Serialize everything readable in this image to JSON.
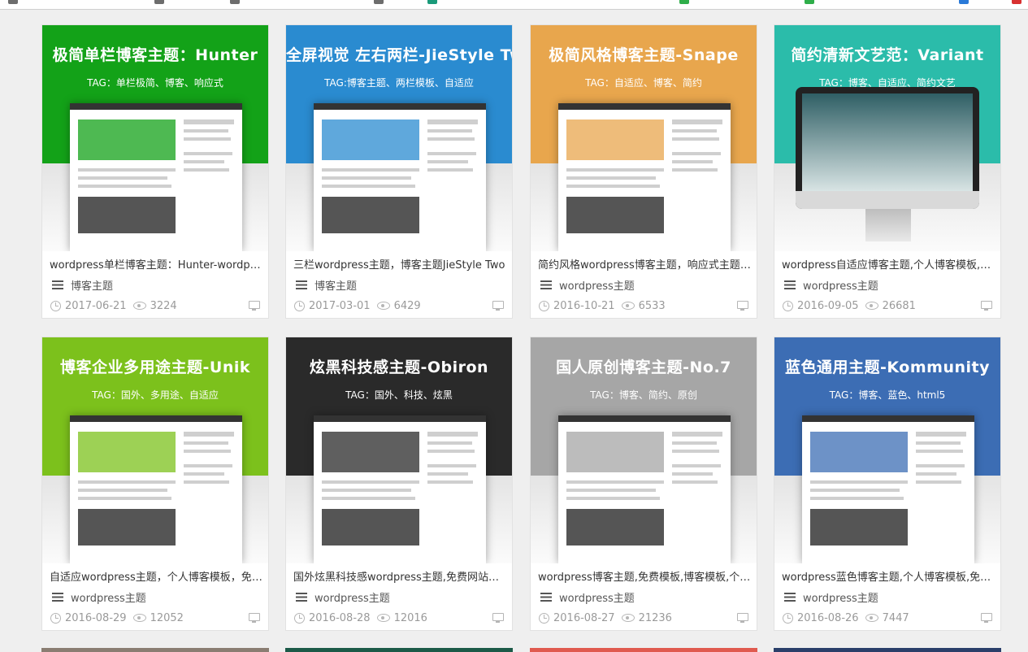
{
  "cards": [
    {
      "title": "极简单栏博客主题：Hunter",
      "tag": "TAG：单栏极简、博客、响应式",
      "bg": "#13a218",
      "desc": "wordpress单栏博客主题：Hunter-wordpress主题",
      "category": "博客主题",
      "date": "2017-06-21",
      "views": "3224",
      "style": "shot"
    },
    {
      "title": "全屏视觉 左右两栏-JieStyle Two",
      "tag": "TAG:博客主题、两栏模板、自适应",
      "bg": "#2a8bd0",
      "desc": "三栏wordpress主题，博客主题JieStyle Two",
      "category": "博客主题",
      "date": "2017-03-01",
      "views": "6429",
      "style": "shot"
    },
    {
      "title": "极简风格博客主题-Snape",
      "tag": "TAG：自适应、博客、简约",
      "bg": "#e8a64d",
      "desc": "简约风格wordpress博客主题，响应式主题-Snape",
      "category": "wordpress主题",
      "date": "2016-10-21",
      "views": "6533",
      "style": "shot"
    },
    {
      "title": "简约清新文艺范：Variant",
      "tag": "TAG：博客、自适应、简约文艺",
      "bg": "#2bbcaa",
      "desc": "wordpress自适应博客主题,个人博客模板,免费主题",
      "category": "wordpress主题",
      "date": "2016-09-05",
      "views": "26681",
      "style": "monitor"
    },
    {
      "title": "博客企业多用途主题-Unik",
      "tag": "TAG：国外、多用途、自适应",
      "bg": "#7cc11c",
      "desc": "自适应wordpress主题，个人博客模板，免费企业主题",
      "category": "wordpress主题",
      "date": "2016-08-29",
      "views": "12052",
      "style": "shot"
    },
    {
      "title": "炫黑科技感主题-Obiron",
      "tag": "TAG：国外、科技、炫黑",
      "bg": "#2a2a2a",
      "desc": "国外炫黑科技感wordpress主题,免费网站模板",
      "category": "wordpress主题",
      "date": "2016-08-28",
      "views": "12016",
      "style": "shot"
    },
    {
      "title": "国人原创博客主题-No.7",
      "tag": "TAG：博客、简约、原创",
      "bg": "#a6a6a6",
      "desc": "wordpress博客主题,免费模板,博客模板,个人主题",
      "category": "wordpress主题",
      "date": "2016-08-27",
      "views": "21236",
      "style": "shot"
    },
    {
      "title": "蓝色通用主题-Kommunity",
      "tag": "TAG：博客、蓝色、html5",
      "bg": "#3c6db4",
      "desc": "wordpress蓝色博客主题,个人博客模板,免费主题",
      "category": "wordpress主题",
      "date": "2016-08-26",
      "views": "7447",
      "style": "shot"
    }
  ],
  "next_row_colors": [
    "#8a7d72",
    "#1c5a48",
    "#e05a4f",
    "#2a3f6a"
  ]
}
